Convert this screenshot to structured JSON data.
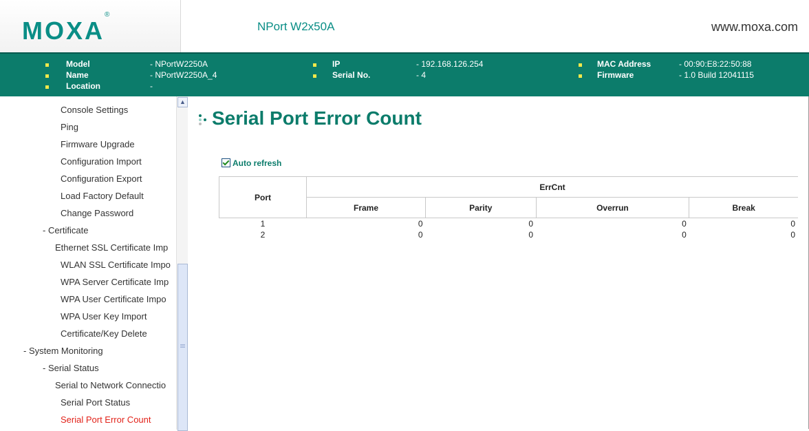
{
  "header": {
    "logo": "MOXA",
    "logo_mark": "®",
    "product": "NPort W2x50A",
    "website": "www.moxa.com"
  },
  "device_info": {
    "model_label": "Model",
    "model_value": "- NPortW2250A",
    "name_label": "Name",
    "name_value": "- NPortW2250A_4",
    "location_label": "Location",
    "location_value": "-",
    "ip_label": "IP",
    "ip_value": "- 192.168.126.254",
    "serial_label": "Serial No.",
    "serial_value": "- 4",
    "mac_label": "MAC Address",
    "mac_value": "- 00:90:E8:22:50:88",
    "firmware_label": "Firmware",
    "firmware_value": "- 1.0 Build 12041115"
  },
  "sidebar": {
    "items": [
      "Console Settings",
      "Ping",
      "Firmware Upgrade",
      "Configuration Import",
      "Configuration Export",
      "Load Factory Default",
      "Change Password",
      "- Certificate",
      "Ethernet SSL Certificate Imp",
      "WLAN SSL Certificate Impo",
      "WPA Server Certificate Imp",
      "WPA User Certificate Impo",
      "WPA User Key Import",
      "Certificate/Key Delete",
      "- System Monitoring",
      "- Serial Status",
      "Serial to Network Connectio",
      "Serial Port Status",
      "Serial Port Error Count"
    ],
    "active": "Serial Port Error Count"
  },
  "main": {
    "title": "Serial Port Error Count",
    "auto_refresh_label": "Auto refresh",
    "auto_refresh_checked": true,
    "table": {
      "port_header": "Port",
      "group_header": "ErrCnt",
      "columns": [
        "Frame",
        "Parity",
        "Overrun",
        "Break"
      ],
      "rows": [
        {
          "port": "1",
          "values": [
            "0",
            "0",
            "0",
            "0"
          ]
        },
        {
          "port": "2",
          "values": [
            "0",
            "0",
            "0",
            "0"
          ]
        }
      ]
    }
  },
  "colors": {
    "brand": "#0c7c6b",
    "logo": "#0a8e86",
    "active_link": "#e2231a",
    "bullet": "#f2e84a"
  }
}
